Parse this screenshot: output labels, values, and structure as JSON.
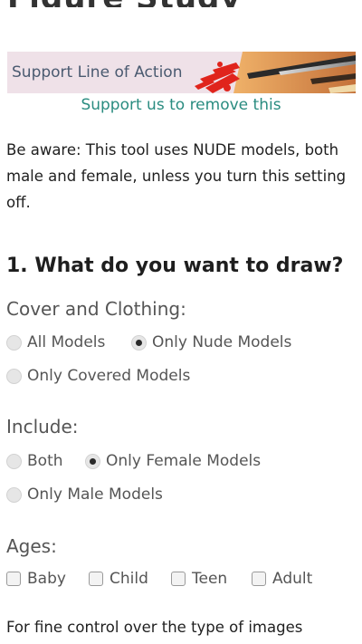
{
  "header": {
    "partial_title": "Figure Study"
  },
  "banner": {
    "label": "Support Line of Action"
  },
  "support_link": {
    "label": "Support us to remove this"
  },
  "warning": {
    "text": "Be aware: This tool uses NUDE models, both male and female, unless you turn this setting off."
  },
  "section": {
    "heading": "1. What do you want to draw?"
  },
  "cover_clothing": {
    "label": "Cover and Clothing:",
    "options": [
      {
        "label": "All Models",
        "checked": false
      },
      {
        "label": "Only Nude Models",
        "checked": true
      },
      {
        "label": "Only Covered Models",
        "checked": false
      }
    ]
  },
  "include": {
    "label": "Include:",
    "options": [
      {
        "label": "Both",
        "checked": false
      },
      {
        "label": "Only Female Models",
        "checked": true
      },
      {
        "label": "Only Male Models",
        "checked": false
      }
    ]
  },
  "ages": {
    "label": "Ages:",
    "options": [
      {
        "label": "Baby",
        "checked": false
      },
      {
        "label": "Child",
        "checked": false
      },
      {
        "label": "Teen",
        "checked": false
      },
      {
        "label": "Adult",
        "checked": false
      }
    ]
  },
  "footer_text": "For fine control over the type of images"
}
